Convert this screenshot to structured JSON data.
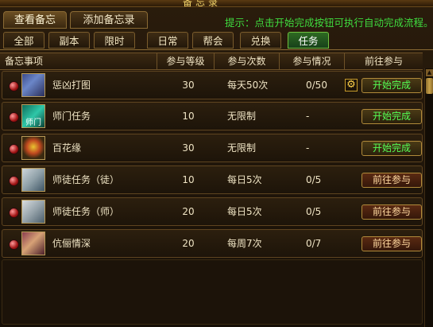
{
  "window": {
    "title": "备忘录"
  },
  "top_tabs": [
    {
      "label": "查看备忘",
      "active": true
    },
    {
      "label": "添加备忘录",
      "active": false
    }
  ],
  "hint_text": "提示：点击开始完成按钮可执行自动完成流程。",
  "category_tabs": [
    {
      "label": "全部"
    },
    {
      "label": "副本"
    },
    {
      "label": "限时"
    },
    {
      "label": "日常"
    },
    {
      "label": "帮会"
    },
    {
      "label": "兑换"
    },
    {
      "label": "任务"
    }
  ],
  "active_category": "任务",
  "columns": [
    "备忘事项",
    "参与等级",
    "参与次数",
    "参与情况",
    "前往参与"
  ],
  "rows": [
    {
      "avatar_icon": "warrior-portrait-icon",
      "avatar_text": "",
      "name": "惩凶打图",
      "level": "30",
      "times": "每天50次",
      "status": "0/50",
      "has_gear": true,
      "button": "开始完成",
      "button_type": "complete"
    },
    {
      "avatar_icon": "mentor-emblem-icon",
      "avatar_text": "师门",
      "name": "师门任务",
      "level": "10",
      "times": "无限制",
      "status": "-",
      "has_gear": false,
      "button": "开始完成",
      "button_type": "complete"
    },
    {
      "avatar_icon": "flower-icon",
      "avatar_text": "",
      "name": "百花缘",
      "level": "30",
      "times": "无限制",
      "status": "-",
      "has_gear": false,
      "button": "开始完成",
      "button_type": "complete"
    },
    {
      "avatar_icon": "elder-portrait-icon",
      "avatar_text": "",
      "name": "师徒任务（徒）",
      "level": "10",
      "times": "每日5次",
      "status": "0/5",
      "has_gear": false,
      "button": "前往参与",
      "button_type": "goto"
    },
    {
      "avatar_icon": "elder-portrait-icon",
      "avatar_text": "",
      "name": "师徒任务（师）",
      "level": "20",
      "times": "每日5次",
      "status": "0/5",
      "has_gear": false,
      "button": "前往参与",
      "button_type": "goto"
    },
    {
      "avatar_icon": "lady-portrait-icon",
      "avatar_text": "",
      "name": "伉俪情深",
      "level": "20",
      "times": "每周7次",
      "status": "0/7",
      "has_gear": false,
      "button": "前往参与",
      "button_type": "goto"
    }
  ],
  "colors": {
    "hint": "#3fdc3f",
    "complete_text": "#55ff55",
    "active_tab": "#2e6a22"
  }
}
